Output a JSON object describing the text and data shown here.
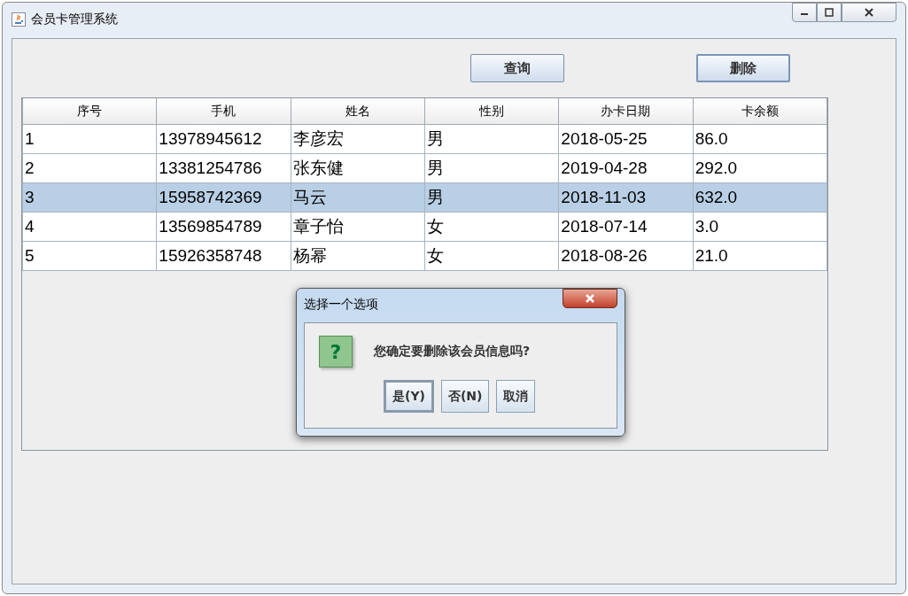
{
  "window": {
    "title": "会员卡管理系统"
  },
  "toolbar": {
    "buttons": [
      {
        "label": "查询",
        "focused": false
      },
      {
        "label": "删除",
        "focused": true
      }
    ]
  },
  "table": {
    "columns": [
      "序号",
      "手机",
      "姓名",
      "性别",
      "办卡日期",
      "卡余额"
    ],
    "rows": [
      {
        "cells": [
          "1",
          "13978945612",
          "李彦宏",
          "男",
          "2018-05-25",
          "86.0"
        ],
        "selected": false
      },
      {
        "cells": [
          "2",
          "13381254786",
          "张东健",
          "男",
          "2019-04-28",
          "292.0"
        ],
        "selected": false
      },
      {
        "cells": [
          "3",
          "15958742369",
          "马云",
          "男",
          "2018-11-03",
          "632.0"
        ],
        "selected": true
      },
      {
        "cells": [
          "4",
          "13569854789",
          "章子怡",
          "女",
          "2018-07-14",
          "3.0"
        ],
        "selected": false
      },
      {
        "cells": [
          "5",
          "15926358748",
          "杨幂",
          "女",
          "2018-08-26",
          "21.0"
        ],
        "selected": false
      }
    ]
  },
  "dialog": {
    "title": "选择一个选项",
    "icon_text": "?",
    "message": "您确定要删除该会员信息吗?",
    "buttons": [
      {
        "label": "是(Y)",
        "focused": true
      },
      {
        "label": "否(N)",
        "focused": false
      },
      {
        "label": "取消",
        "focused": false
      }
    ]
  }
}
